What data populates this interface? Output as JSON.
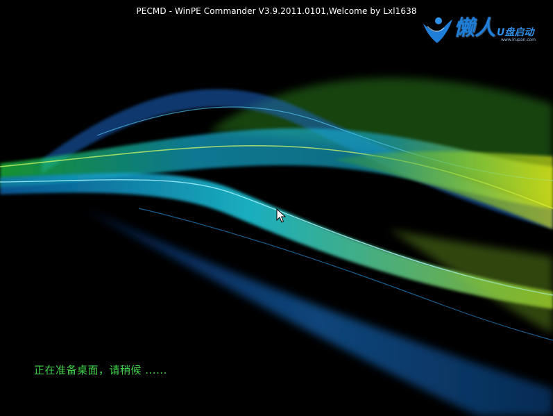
{
  "screen": {
    "title": "PECMD - WinPE Commander V3.9.2011.0101,Welcome by Lxl1638",
    "status": "正在准备桌面，请稍候 ......"
  },
  "logo": {
    "main": "懒人",
    "sub": "U盘启动",
    "url": "www.lrupan.com"
  },
  "colors": {
    "background": "#000000",
    "status_text": "#3fd04a",
    "title_text": "#ffffff",
    "logo_blue": "#1f7fd8"
  },
  "icons": {
    "cursor": "arrow-cursor-icon",
    "logo": "lazy-person-logo-icon"
  }
}
